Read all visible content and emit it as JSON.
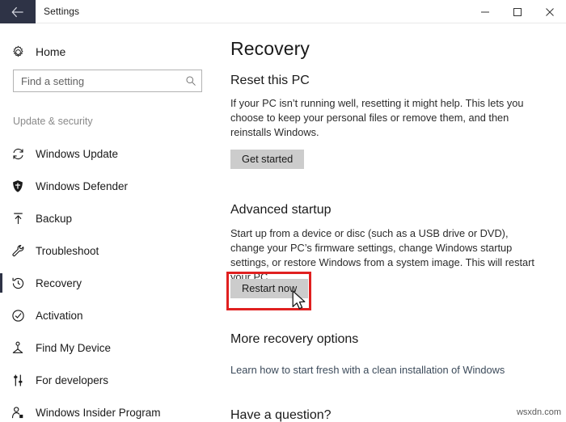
{
  "window": {
    "title": "Settings",
    "back_icon": "back-arrow-icon",
    "minimize_label": "Minimize",
    "maximize_label": "Maximize",
    "close_label": "Close"
  },
  "sidebar": {
    "home": {
      "label": "Home",
      "icon": "gear-icon"
    },
    "search": {
      "placeholder": "Find a setting",
      "value": "",
      "icon": "search-icon"
    },
    "group_label": "Update & security",
    "items": [
      {
        "label": "Windows Update",
        "icon": "refresh-icon",
        "selected": false
      },
      {
        "label": "Windows Defender",
        "icon": "shield-icon",
        "selected": false
      },
      {
        "label": "Backup",
        "icon": "backup-upload-icon",
        "selected": false
      },
      {
        "label": "Troubleshoot",
        "icon": "wrench-icon",
        "selected": false
      },
      {
        "label": "Recovery",
        "icon": "history-clock-icon",
        "selected": true
      },
      {
        "label": "Activation",
        "icon": "check-circle-icon",
        "selected": false
      },
      {
        "label": "Find My Device",
        "icon": "find-device-icon",
        "selected": false
      },
      {
        "label": "For developers",
        "icon": "sliders-icon",
        "selected": false
      },
      {
        "label": "Windows Insider Program",
        "icon": "person-badge-icon",
        "selected": false
      }
    ]
  },
  "main": {
    "page_title": "Recovery",
    "sections": [
      {
        "heading": "Reset this PC",
        "body": "If your PC isn’t running well, resetting it might help. This lets you choose to keep your personal files or remove them, and then reinstalls Windows.",
        "button": "Get started"
      },
      {
        "heading": "Advanced startup",
        "body": "Start up from a device or disc (such as a USB drive or DVD), change your PC’s firmware settings, change Windows startup settings, or restore Windows from a system image. This will restart your PC.",
        "button": "Restart now"
      },
      {
        "heading": "More recovery options",
        "link": "Learn how to start fresh with a clean installation of Windows"
      },
      {
        "heading": "Have a question?"
      }
    ]
  },
  "annotation": {
    "highlight_color": "#e02020",
    "target": "Restart now",
    "cursor": "arrow-pointer"
  },
  "watermark": "wsxdn.com",
  "colors": {
    "titlebar_accent": "#2e3346",
    "button_gray": "#cccccc",
    "link": "#3b4a5a",
    "muted_text": "#8a8a8a"
  }
}
